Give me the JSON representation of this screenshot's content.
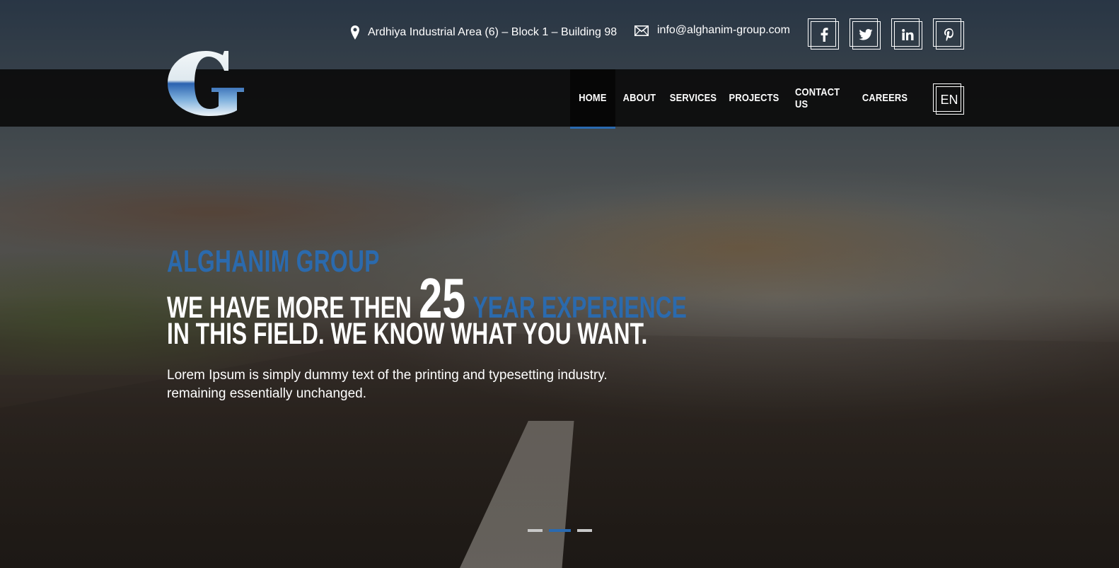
{
  "topbar": {
    "address": "Ardhiya Industrial Area (6) – Block 1 – Building 98",
    "email": "info@alghanim-group.com",
    "social": [
      {
        "name": "facebook",
        "glyph": "f"
      },
      {
        "name": "twitter",
        "glyph": "🐦"
      },
      {
        "name": "linkedin",
        "glyph": "in"
      },
      {
        "name": "pinterest",
        "glyph": "P"
      }
    ]
  },
  "nav": {
    "items": [
      "HOME",
      "ABOUT",
      "SERVICES",
      "PROJECTS",
      "CONTACT US",
      "CAREERS"
    ],
    "active": "HOME",
    "language": "EN"
  },
  "hero": {
    "brand": "ALGHANIM GROUP",
    "line1_pre": "WE HAVE MORE THEN",
    "line1_number": "25",
    "line1_post": "YEAR EXPERIENCE",
    "line2": "IN THIS FIELD. WE KNOW WHAT YOU WANT.",
    "description_line1": "Lorem Ipsum is simply dummy text of the printing and typesetting industry.",
    "description_line2": "remaining essentially unchanged."
  },
  "slider": {
    "slides": 3,
    "active_index": 1
  },
  "colors": {
    "accent": "#2b6aad",
    "nav_bg": "#0c0c0c",
    "text": "#ffffff"
  }
}
